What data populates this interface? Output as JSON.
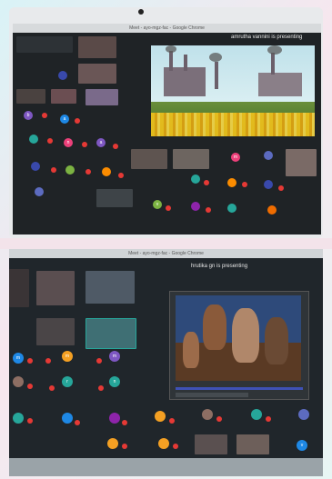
{
  "top_photo": {
    "titlebar": "Meet - ayo-mgz-fac - Google Chrome",
    "presenter_banner": "amrutha vannini is presenting",
    "tile_letters": [
      "b",
      "a",
      "n",
      "a",
      "m",
      "v"
    ],
    "colors": {
      "screen": "#1f2326",
      "tile_dark": "#3a3f44",
      "avatar_teal": "#26a69a",
      "avatar_purple": "#7e57c2",
      "avatar_pink": "#ec407a",
      "avatar_blue": "#1e88e5",
      "avatar_orange": "#fb8c00",
      "badge_red": "#e53935",
      "field_yellow": "#f2c21b"
    }
  },
  "bottom_photo": {
    "titlebar": "Meet - ayo-mgz-fac - Google Chrome",
    "presenter_banner": "hrutika gn is presenting",
    "tile_letters": [
      "m",
      "m",
      "m",
      "r",
      "n",
      "v"
    ],
    "colors": {
      "screen": "#20262b",
      "avatar_teal": "#26a69a",
      "avatar_orange": "#f4a023",
      "avatar_brown": "#8d6e63",
      "avatar_blue": "#1e88e5",
      "avatar_purple": "#7e57c2",
      "badge_red": "#e53935"
    }
  }
}
